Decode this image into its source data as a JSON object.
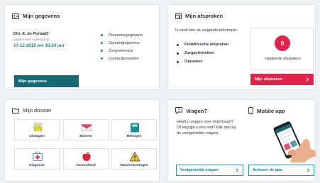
{
  "colors": {
    "teal": "#176a75",
    "teal_text": "#1b7d86",
    "red": "#e2244b",
    "card_border": "#dde3e8",
    "background": "#eef1f4"
  },
  "gegevens": {
    "title": "Mijn gegevens",
    "icon": "id-card-icon",
    "name": "Dhr. E. de Portaal5",
    "login_label": "Laatste keer ingelogd op:",
    "login_time": "17-12-2019 om 10:24 uur",
    "links": [
      "Persoonsgegevens",
      "Contactgegevens",
      "Zorgverleners",
      "Contactpersonen"
    ],
    "button_label": "Mijn gegevens"
  },
  "afspraken": {
    "title": "Mijn afspraken",
    "icon": "calendar-icon",
    "intro": "U vindt hier de volgende informatie:",
    "items": [
      "Poliklinische afspraken",
      "Zorgactiviteiten",
      "Opnames"
    ],
    "count": "0",
    "count_label": "Geplande afspraken",
    "button_label": "Mijn afspraken",
    "button_icon": "chevron-right-icon"
  },
  "dossier": {
    "title": "Mijn dossier",
    "icon": "folder-icon",
    "tiles": [
      {
        "label": "Uitslagen",
        "icon": "test-tubes-icon"
      },
      {
        "label": "Brieven",
        "icon": "envelope-icon"
      },
      {
        "label": "Metingen",
        "icon": "scale-icon"
      },
      {
        "label": "Diagnose",
        "icon": "medical-kit-icon"
      },
      {
        "label": "Gezondheid",
        "icon": "apple-icon"
      },
      {
        "label": "Waarschuwingen",
        "icon": "warning-icon"
      }
    ]
  },
  "vragen": {
    "title": "Vragen?",
    "icon": "question-icon",
    "text": "Heeft u vragen over mijnTreant? Of begrijpt u iets niet? Kijk dan bij de veelgestelde vragen.",
    "button_label": "Veelgestelde vragen",
    "button_icon": "chevron-right-icon"
  },
  "mobile": {
    "title": "Mobile app",
    "icon": "mobile-phone-icon",
    "button_label": "Activeer de app",
    "button_icon": "chevron-right-icon"
  }
}
